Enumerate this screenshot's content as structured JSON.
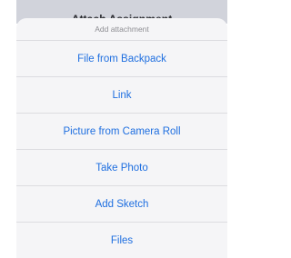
{
  "background": {
    "title": "Attach Assignment"
  },
  "action_sheet": {
    "title": "Add attachment",
    "options": [
      {
        "label": "File from Backpack"
      },
      {
        "label": "Link"
      },
      {
        "label": "Picture from Camera Roll"
      },
      {
        "label": "Take Photo"
      },
      {
        "label": "Add Sketch"
      },
      {
        "label": "Files"
      }
    ]
  },
  "colors": {
    "accent": "#1f6fe0",
    "sheet_background": "#f5f5f7",
    "separator": "#dcdce0",
    "subtitle": "#8e8e93"
  }
}
